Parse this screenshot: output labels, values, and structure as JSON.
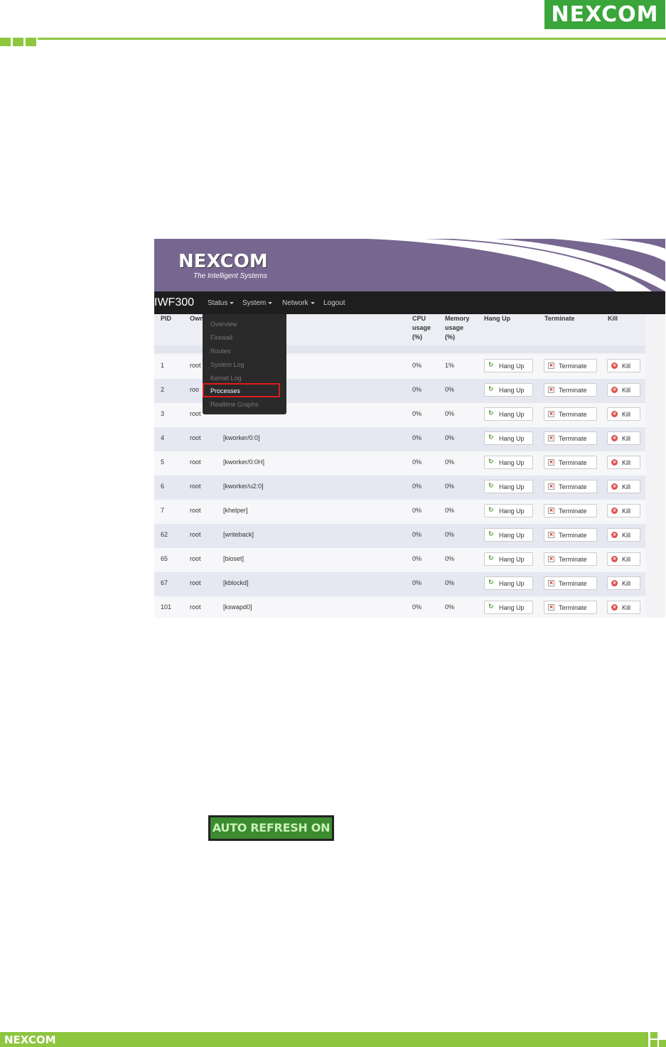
{
  "header": {
    "logo": "NEXCOM"
  },
  "footer": {
    "logo": "NEXCOM"
  },
  "screenshot": {
    "banner": {
      "logo": "NEXCOM",
      "tagline": "The Intelligent Systems"
    },
    "nav": {
      "brand": "IWF300",
      "items": [
        "Status",
        "System",
        "Network",
        "Logout"
      ]
    },
    "dropdown": {
      "items": [
        "Overview",
        "Firewall",
        "Routes",
        "System Log",
        "Kernel Log",
        "Processes",
        "Realtime Graphs"
      ],
      "active": "Processes"
    },
    "table": {
      "headers": {
        "pid": "PID",
        "owner": "Own",
        "cpu": [
          "CPU",
          "usage",
          "(%)"
        ],
        "memory": [
          "Memory",
          "usage",
          "(%)"
        ],
        "hangup": "Hang Up",
        "terminate": "Terminate",
        "kill": "Kill"
      },
      "buttons": {
        "hangup": "Hang Up",
        "terminate": "Terminate",
        "kill": "Kill"
      },
      "rows": [
        {
          "pid": "1",
          "owner": "root",
          "command": "",
          "cpu": "0%",
          "mem": "1%"
        },
        {
          "pid": "2",
          "owner": "roo",
          "command": "",
          "cpu": "0%",
          "mem": "0%"
        },
        {
          "pid": "3",
          "owner": "root",
          "command": "",
          "cpu": "0%",
          "mem": "0%"
        },
        {
          "pid": "4",
          "owner": "root",
          "command": "[kworker/0:0]",
          "cpu": "0%",
          "mem": "0%"
        },
        {
          "pid": "5",
          "owner": "root",
          "command": "[kworker/0:0H]",
          "cpu": "0%",
          "mem": "0%"
        },
        {
          "pid": "6",
          "owner": "root",
          "command": "[kworker/u2:0]",
          "cpu": "0%",
          "mem": "0%"
        },
        {
          "pid": "7",
          "owner": "root",
          "command": "[khelper]",
          "cpu": "0%",
          "mem": "0%"
        },
        {
          "pid": "62",
          "owner": "root",
          "command": "[writeback]",
          "cpu": "0%",
          "mem": "0%"
        },
        {
          "pid": "65",
          "owner": "root",
          "command": "[bioset]",
          "cpu": "0%",
          "mem": "0%"
        },
        {
          "pid": "67",
          "owner": "root",
          "command": "[kblockd]",
          "cpu": "0%",
          "mem": "0%"
        },
        {
          "pid": "101",
          "owner": "root",
          "command": "[kswapd0]",
          "cpu": "0%",
          "mem": "0%"
        }
      ]
    }
  },
  "auto_refresh": {
    "label": "AUTO REFRESH ON"
  }
}
